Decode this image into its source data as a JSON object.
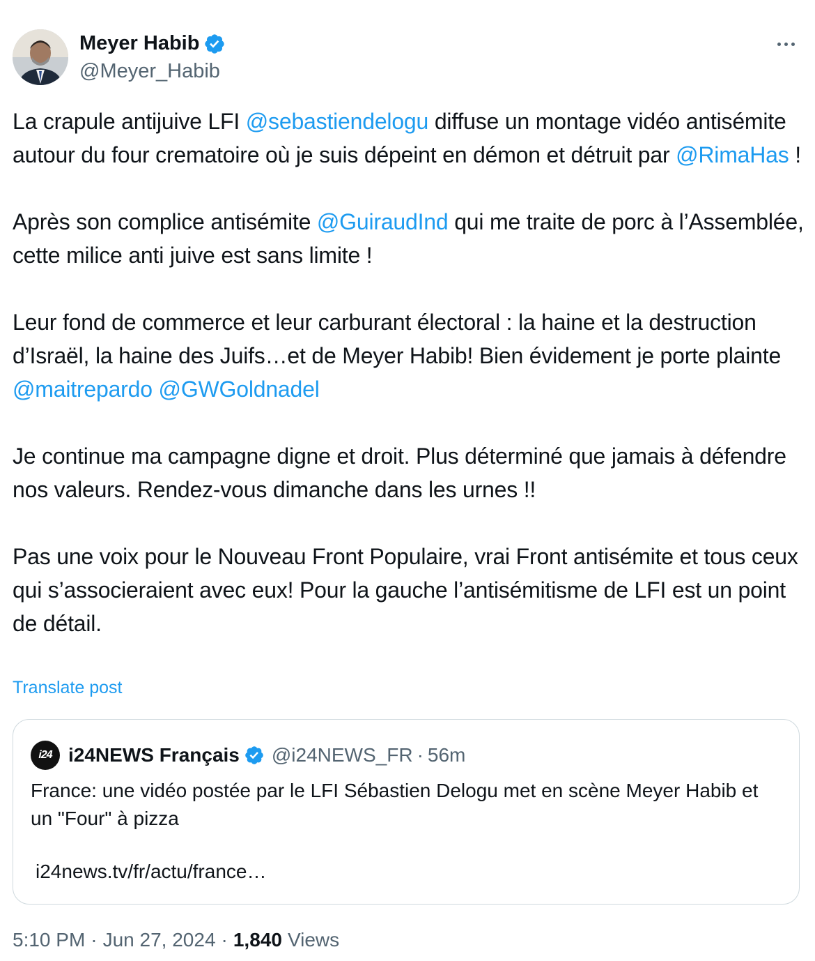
{
  "author": {
    "display_name": "Meyer Habib",
    "handle": "@Meyer_Habib",
    "verified_color": "#1d9bf0"
  },
  "post": {
    "paragraphs": [
      {
        "segments": [
          {
            "text": "La crapule antijuive LFI ",
            "mention": false
          },
          {
            "text": "@sebastiendelogu",
            "mention": true
          },
          {
            "text": " diffuse un montage vidéo antisémite autour du four crematoire où je suis dépeint en démon et détruit par ",
            "mention": false
          },
          {
            "text": "@RimaHas",
            "mention": true
          },
          {
            "text": " !",
            "mention": false
          }
        ]
      },
      {
        "segments": [
          {
            "text": "Après son complice antisémite ",
            "mention": false
          },
          {
            "text": "@GuiraudInd",
            "mention": true
          },
          {
            "text": " qui me traite de porc à l’Assemblée, cette milice anti juive est sans limite !",
            "mention": false
          }
        ]
      },
      {
        "segments": [
          {
            "text": "Leur fond de commerce et leur carburant électoral : la haine et la destruction d’Israël, la haine des Juifs…et de Meyer Habib!  Bien évidement je porte plainte ",
            "mention": false
          },
          {
            "text": "@maitrepardo",
            "mention": true
          },
          {
            "text": " ",
            "mention": false
          },
          {
            "text": "@GWGoldnadel",
            "mention": true
          }
        ]
      },
      {
        "segments": [
          {
            "text": "Je continue ma campagne digne et droit. Plus déterminé que jamais à défendre nos valeurs. Rendez-vous dimanche dans les urnes !!",
            "mention": false
          }
        ]
      },
      {
        "segments": [
          {
            "text": "Pas une voix pour le Nouveau Front Populaire, vrai Front antisémite et tous ceux qui s’associeraient avec eux! Pour la gauche l’antisémitisme de LFI est un point de détail.",
            "mention": false
          }
        ]
      }
    ],
    "translate_label": "Translate post"
  },
  "quote": {
    "logo_text": "i24",
    "display_name": "i24NEWS Français",
    "handle": "@i24NEWS_FR",
    "separator": "·",
    "time": "56m",
    "text": "France: une vidéo postée par le LFI Sébastien Delogu met en scène Meyer Habib et un \"Four\" à pizza",
    "link": "i24news.tv/fr/actu/france…"
  },
  "meta": {
    "time": "5:10 PM",
    "date": "Jun 27, 2024",
    "separator": "·",
    "views_count": "1,840",
    "views_label": "Views"
  },
  "icons": {
    "more": "more-horizontal-icon",
    "verified": "verified-badge-icon"
  }
}
